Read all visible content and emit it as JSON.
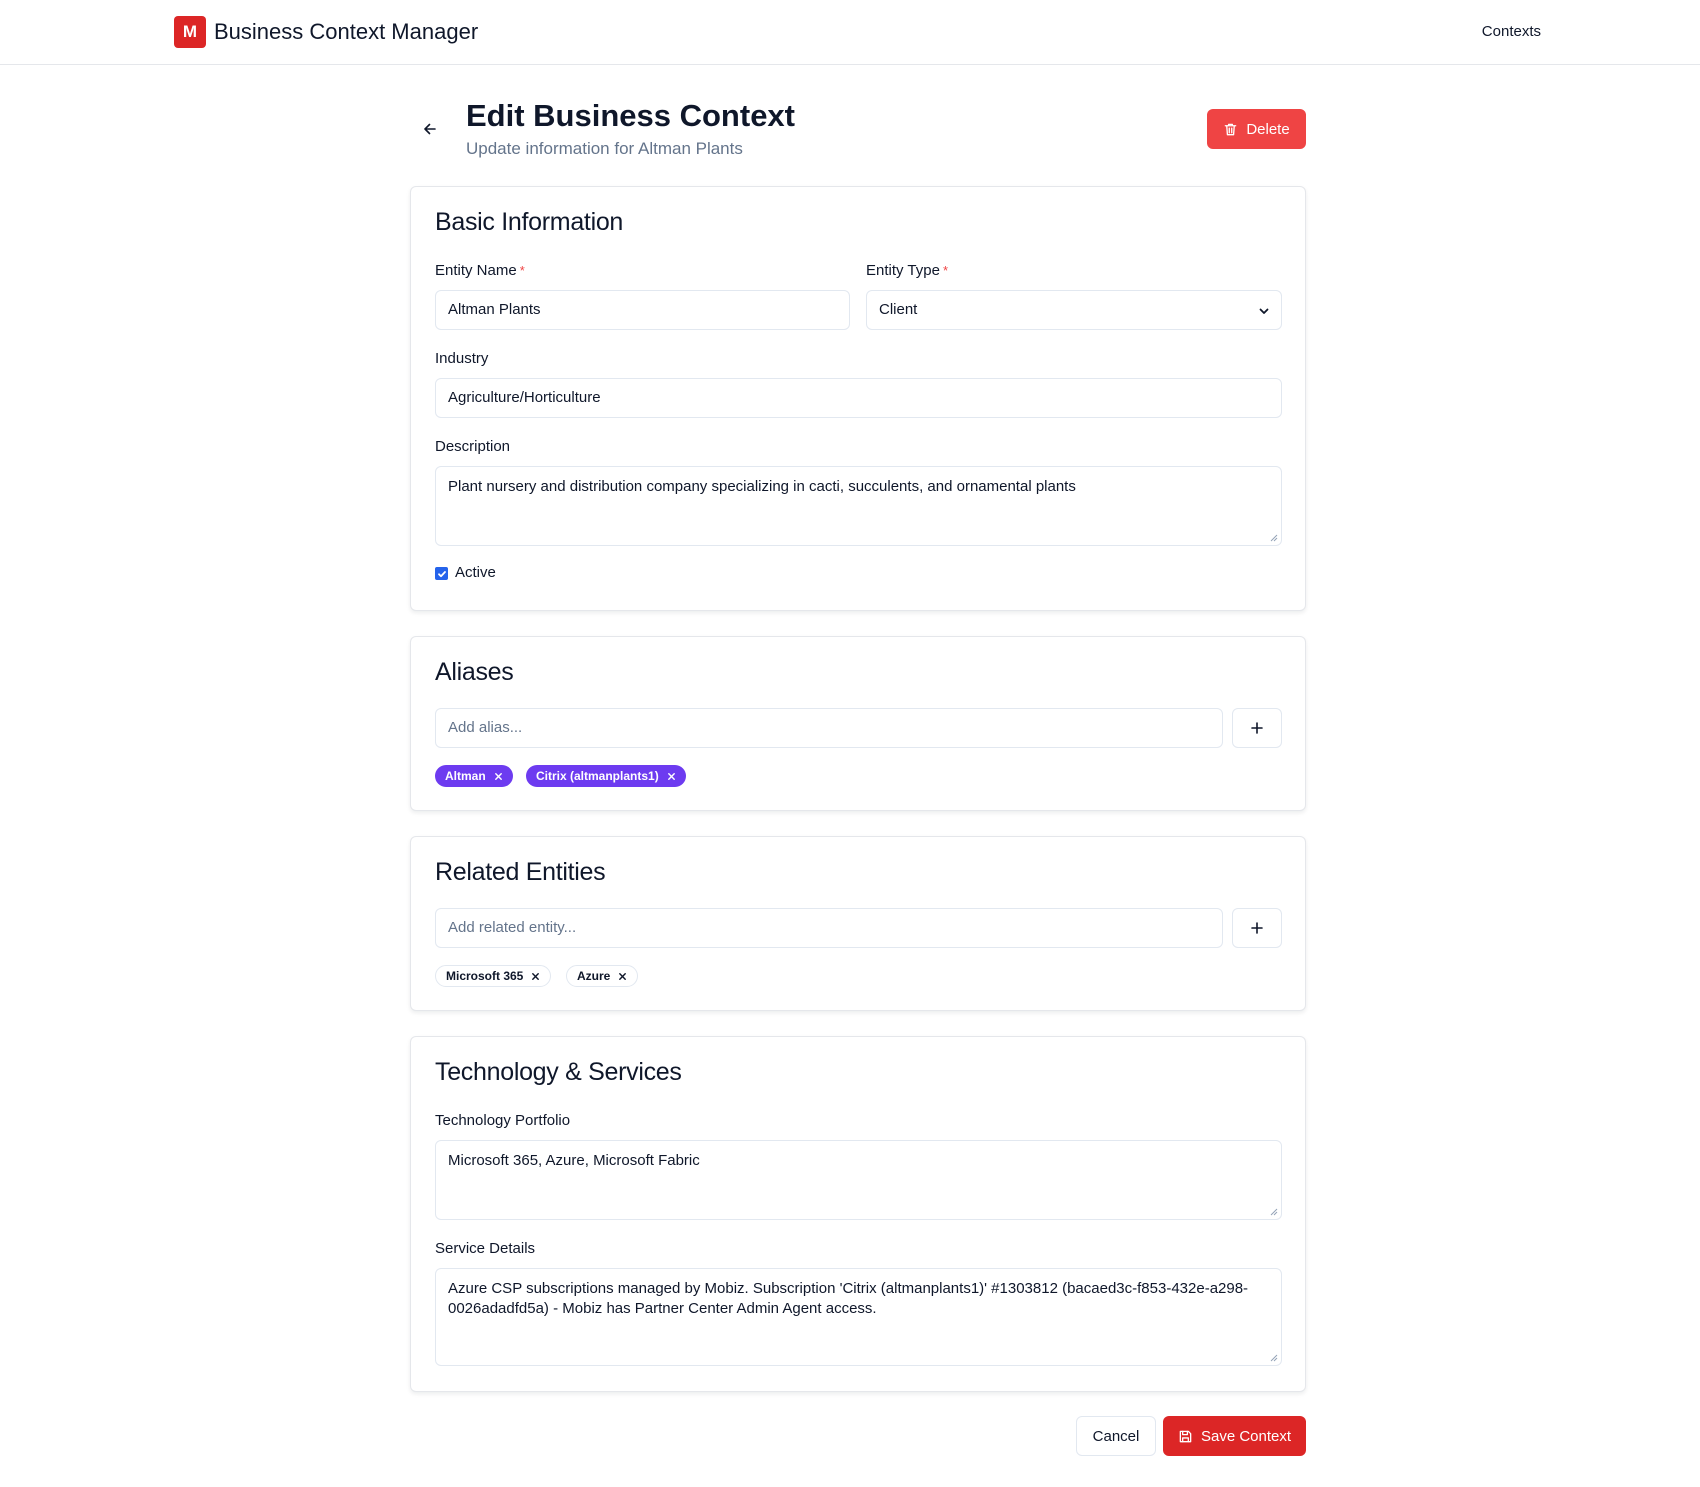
{
  "app": {
    "logo_letter": "M",
    "title": "Business Context Manager",
    "nav_contexts": "Contexts",
    "brand_color": "#dc2626"
  },
  "page": {
    "title": "Edit Business Context",
    "subtitle": "Update information for Altman Plants",
    "delete_label": "Delete",
    "back_icon": "arrow-left-icon"
  },
  "basic": {
    "title": "Basic Information",
    "entity_name_label": "Entity Name",
    "entity_name_value": "Altman Plants",
    "entity_type_label": "Entity Type",
    "entity_type_value": "Client",
    "required_mark": "*",
    "industry_label": "Industry",
    "industry_value": "Agriculture/Horticulture",
    "description_label": "Description",
    "description_value": "Plant nursery and distribution company specializing in cacti, succulents, and ornamental plants",
    "active_label": "Active",
    "active_checked": true
  },
  "aliases": {
    "title": "Aliases",
    "input_placeholder": "Add alias...",
    "items": [
      "Altman",
      "Citrix (altmanplants1)"
    ],
    "chip_color": "#6d3bf0"
  },
  "related": {
    "title": "Related Entities",
    "input_placeholder": "Add related entity...",
    "items": [
      "Microsoft 365",
      "Azure"
    ]
  },
  "tech": {
    "title": "Technology & Services",
    "portfolio_label": "Technology Portfolio",
    "portfolio_value": "Microsoft 365, Azure, Microsoft Fabric",
    "service_label": "Service Details",
    "service_value": "Azure CSP subscriptions managed by Mobiz. Subscription 'Citrix (altmanplants1)' #1303812 (bacaed3c-f853-432e-a298-0026adadfd5a) - Mobiz has Partner Center Admin Agent access."
  },
  "footer": {
    "cancel_label": "Cancel",
    "save_label": "Save Context"
  }
}
